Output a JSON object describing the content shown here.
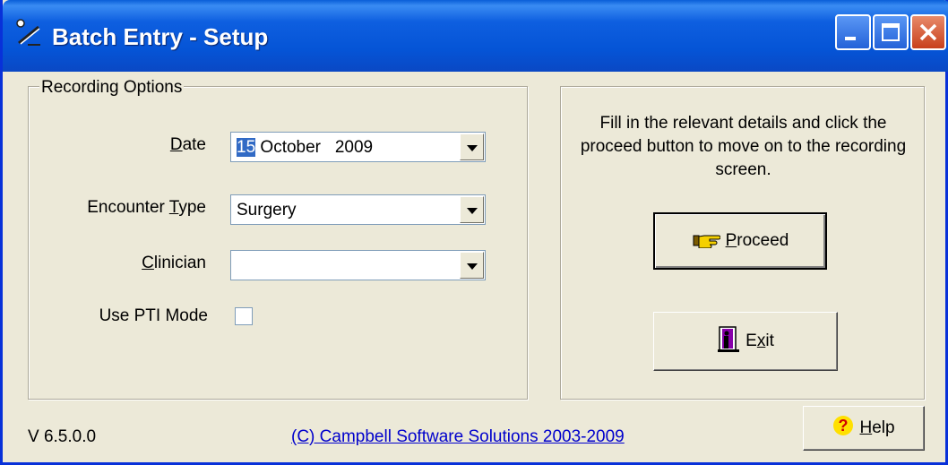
{
  "window": {
    "title": "Batch Entry - Setup"
  },
  "recording_options": {
    "legend": "Recording Options",
    "date": {
      "label_pre": "",
      "label_acc": "D",
      "label_post": "ate",
      "day": "15",
      "month_year": " October   2009"
    },
    "encounter_type": {
      "label_pre": "Encounter ",
      "label_acc": "T",
      "label_post": "ype",
      "value": "Surgery"
    },
    "clinician": {
      "label_pre": "",
      "label_acc": "C",
      "label_post": "linician",
      "value": ""
    },
    "pti_mode": {
      "label": "Use PTI Mode",
      "checked": false
    }
  },
  "info": {
    "text": "Fill in the relevant details and click the proceed button to move on to the recording screen."
  },
  "buttons": {
    "proceed": {
      "pre": "",
      "acc": "P",
      "post": "roceed",
      "icon": "hand-pointer-icon"
    },
    "exit": {
      "pre": "E",
      "acc": "x",
      "post": "it",
      "icon": "door-exit-icon"
    },
    "help": {
      "pre": "",
      "acc": "H",
      "post": "elp",
      "icon": "question-icon"
    }
  },
  "footer": {
    "version": "V 6.5.0.0",
    "copyright": "(C) Campbell Software Solutions 2003-2009"
  },
  "colors": {
    "titlebar": "#0554d6",
    "face": "#ece9d8",
    "link": "#0000cc",
    "selection": "#316ac5"
  }
}
